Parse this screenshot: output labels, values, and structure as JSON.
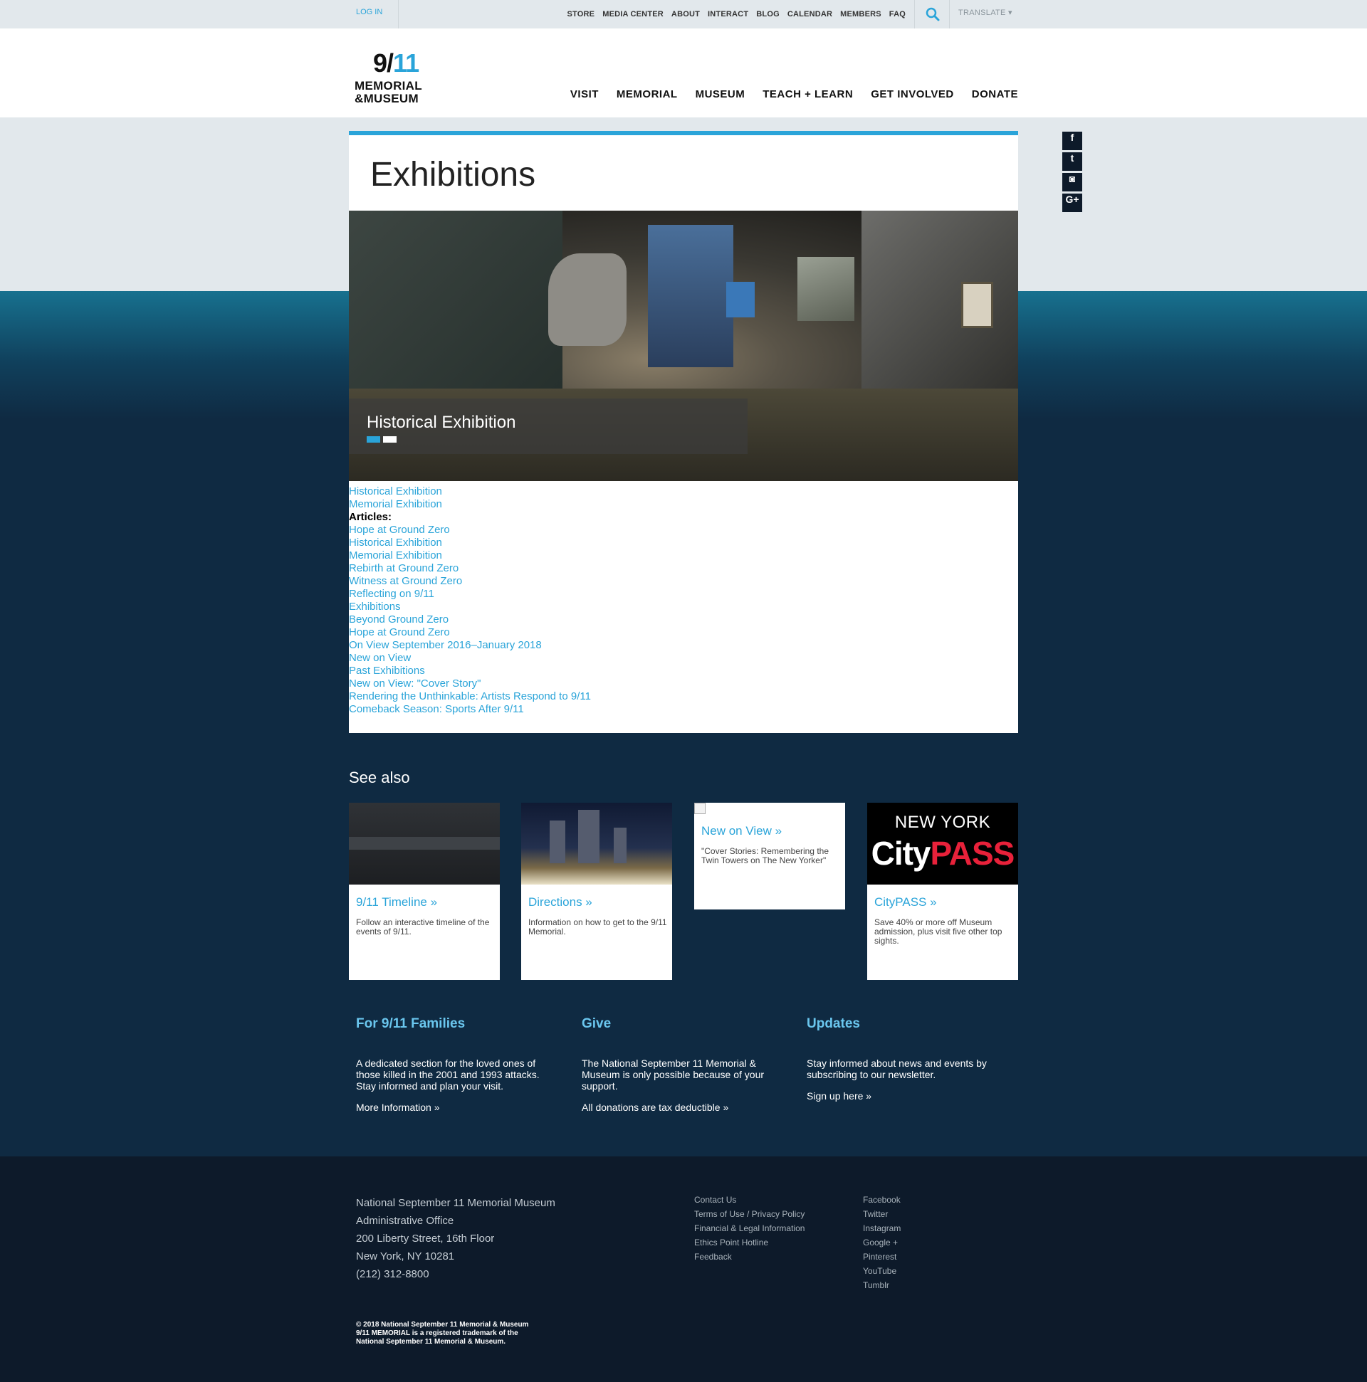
{
  "utilbar": {
    "login": "LOG IN",
    "links": [
      "STORE",
      "MEDIA CENTER",
      "ABOUT",
      "INTERACT",
      "BLOG",
      "CALENDAR",
      "MEMBERS",
      "FAQ"
    ],
    "translate": "TRANSLATE ▾"
  },
  "logo": {
    "line1a": "9/",
    "line1b": "11",
    "line2": "MEMORIAL",
    "line3": "&MUSEUM"
  },
  "nav": [
    "VISIT",
    "MEMORIAL",
    "MUSEUM",
    "TEACH + LEARN",
    "GET INVOLVED",
    "DONATE"
  ],
  "social": [
    "f",
    "t",
    "◙",
    "G+"
  ],
  "page": {
    "title": "Exhibitions",
    "hero_caption": "Historical Exhibition"
  },
  "links": [
    {
      "text": "Historical Exhibition",
      "header": false
    },
    {
      "text": "Memorial Exhibition",
      "header": false
    },
    {
      "text": "Articles:",
      "header": true
    },
    {
      "text": "Hope at Ground Zero",
      "header": false
    },
    {
      "text": "Historical Exhibition",
      "header": false
    },
    {
      "text": "Memorial Exhibition",
      "header": false
    },
    {
      "text": "Rebirth at Ground Zero",
      "header": false
    },
    {
      "text": "Witness at Ground Zero",
      "header": false
    },
    {
      "text": "Reflecting on 9/11",
      "header": false
    },
    {
      "text": "Exhibitions",
      "header": false
    },
    {
      "text": "Beyond Ground Zero",
      "header": false
    },
    {
      "text": "Hope at Ground Zero",
      "header": false
    },
    {
      "text": "On View September 2016–January 2018",
      "header": false
    },
    {
      "text": "New on View",
      "header": false
    },
    {
      "text": "Past Exhibitions",
      "header": false
    },
    {
      "text": "New on View: \"Cover Story\"",
      "header": false
    },
    {
      "text": "Rendering the Unthinkable: Artists Respond to 9/11",
      "header": false
    },
    {
      "text": "Comeback Season: Sports After 9/11",
      "header": false
    }
  ],
  "seealso": {
    "title": "See also",
    "tiles": [
      {
        "title": "9/11 Timeline »",
        "desc": "Follow an interactive timeline of the events of 9/11."
      },
      {
        "title": "Directions »",
        "desc": "Information on how to get to the 9/11 Memorial."
      },
      {
        "title": "New on View »",
        "desc": "\"Cover Stories: Remembering the Twin Towers on The New Yorker\""
      },
      {
        "title": "CityPASS »",
        "desc": "Save 40% or more off Museum admission, plus visit five other top sights."
      }
    ],
    "citypass_ny": "NEW YORK",
    "citypass_city": "City",
    "citypass_pass": "PASS"
  },
  "info": [
    {
      "title": "For 9/11 Families",
      "text": "A dedicated section for the loved ones of those killed in the 2001 and 1993 attacks. Stay informed and plan your visit.",
      "link": "More Information »"
    },
    {
      "title": "Give",
      "text": "The National September 11 Memorial & Museum is only possible because of your support.",
      "link": "All donations are tax deductible »"
    },
    {
      "title": "Updates",
      "text": "Stay informed about news and events by subscribing to our newsletter.",
      "link": "Sign up here »"
    }
  ],
  "footer": {
    "address": [
      "National September 11 Memorial Museum",
      "Administrative Office",
      "200 Liberty Street, 16th Floor",
      "New York, NY 10281",
      "(212) 312-8800"
    ],
    "links1": [
      "Contact Us",
      "Terms of Use / Privacy Policy",
      "Financial & Legal Information",
      "Ethics Point Hotline",
      "Feedback"
    ],
    "links2": [
      "Facebook",
      "Twitter",
      "Instagram",
      "Google +",
      "Pinterest",
      "YouTube",
      "Tumblr"
    ],
    "copyright": [
      "© 2018 National September 11 Memorial & Museum",
      "9/11 MEMORIAL is a registered trademark of the",
      "National September 11 Memorial & Museum."
    ]
  },
  "colors": {
    "accent": "#2aa4d9",
    "navy": "#0f2a42",
    "footer": "#0d1a2a",
    "gray": "#e2e8ec"
  }
}
